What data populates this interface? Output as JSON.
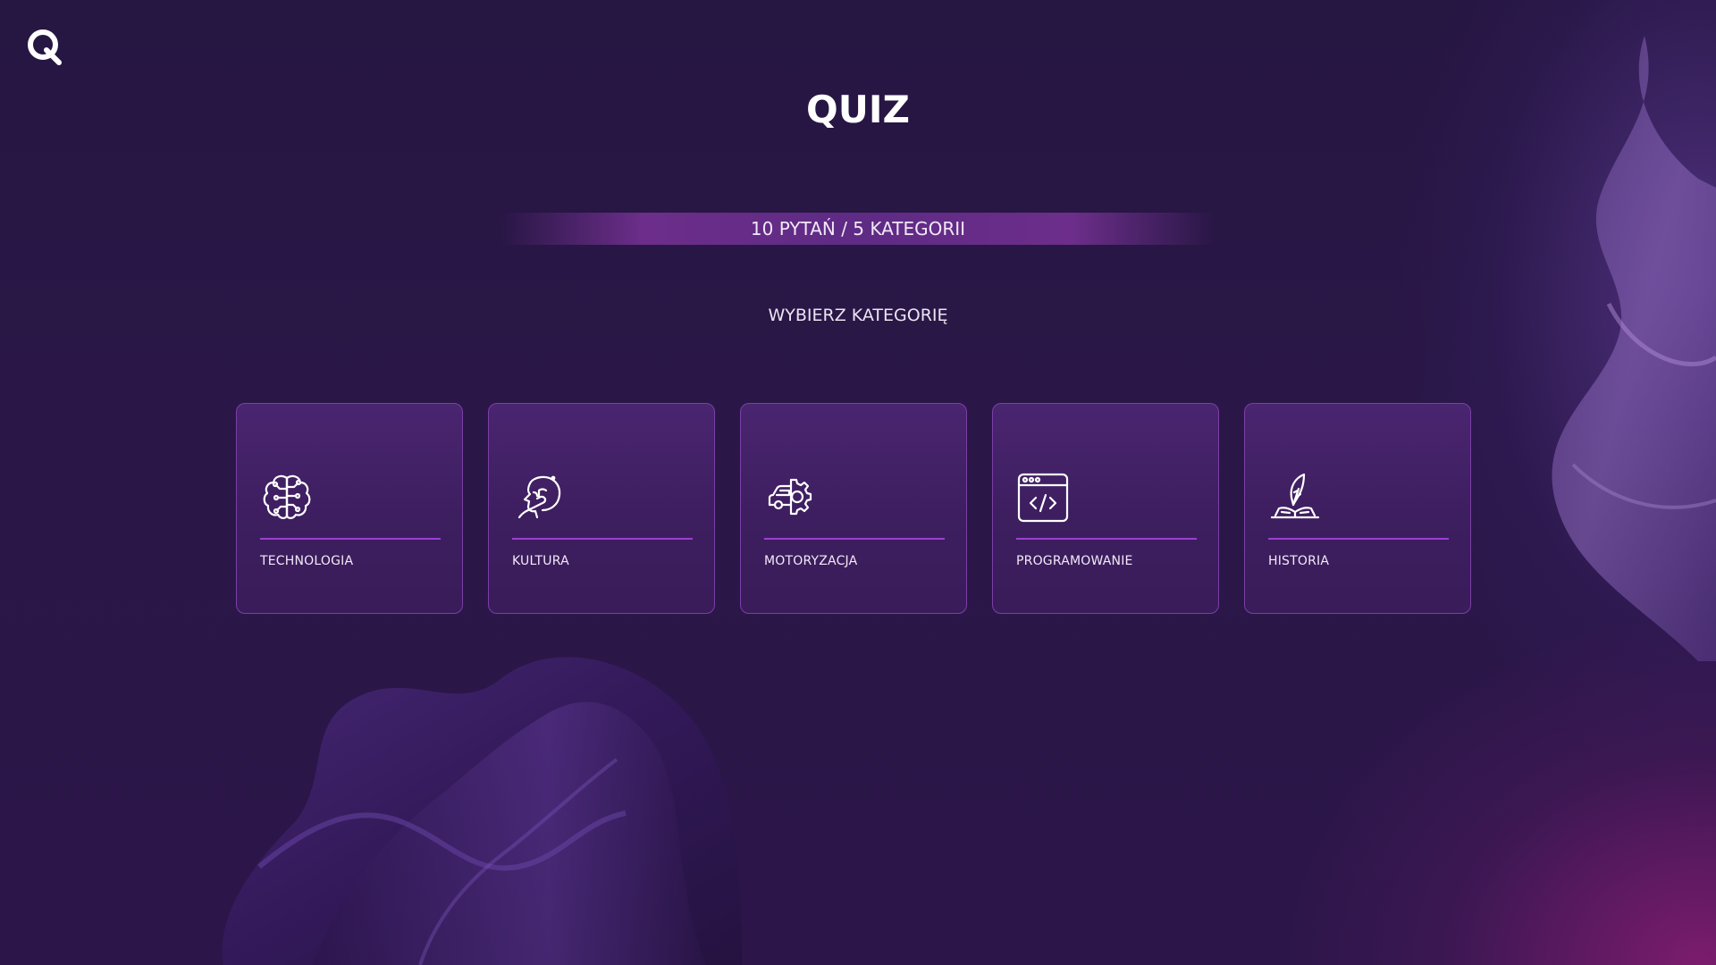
{
  "app": {
    "logo_icon": "quiz-q-logo-icon"
  },
  "header": {
    "title": "QUIZ"
  },
  "info": {
    "summary": "10 PYTAŃ / 5 KATEGORII"
  },
  "prompt": {
    "label": "WYBIERZ KATEGORIĘ"
  },
  "categories": [
    {
      "label": "TECHNOLOGIA",
      "icon": "brain-circuit-icon"
    },
    {
      "label": "KULTURA",
      "icon": "thinking-head-icon"
    },
    {
      "label": "MOTORYZACJA",
      "icon": "car-gear-icon"
    },
    {
      "label": "PROGRAMOWANIE",
      "icon": "code-window-icon"
    },
    {
      "label": "HISTORIA",
      "icon": "quill-book-icon"
    }
  ],
  "colors": {
    "background": "#271744",
    "card_border": "#7a3fa6",
    "card_divider": "#9c3fd0",
    "accent_pink": "#962878"
  }
}
